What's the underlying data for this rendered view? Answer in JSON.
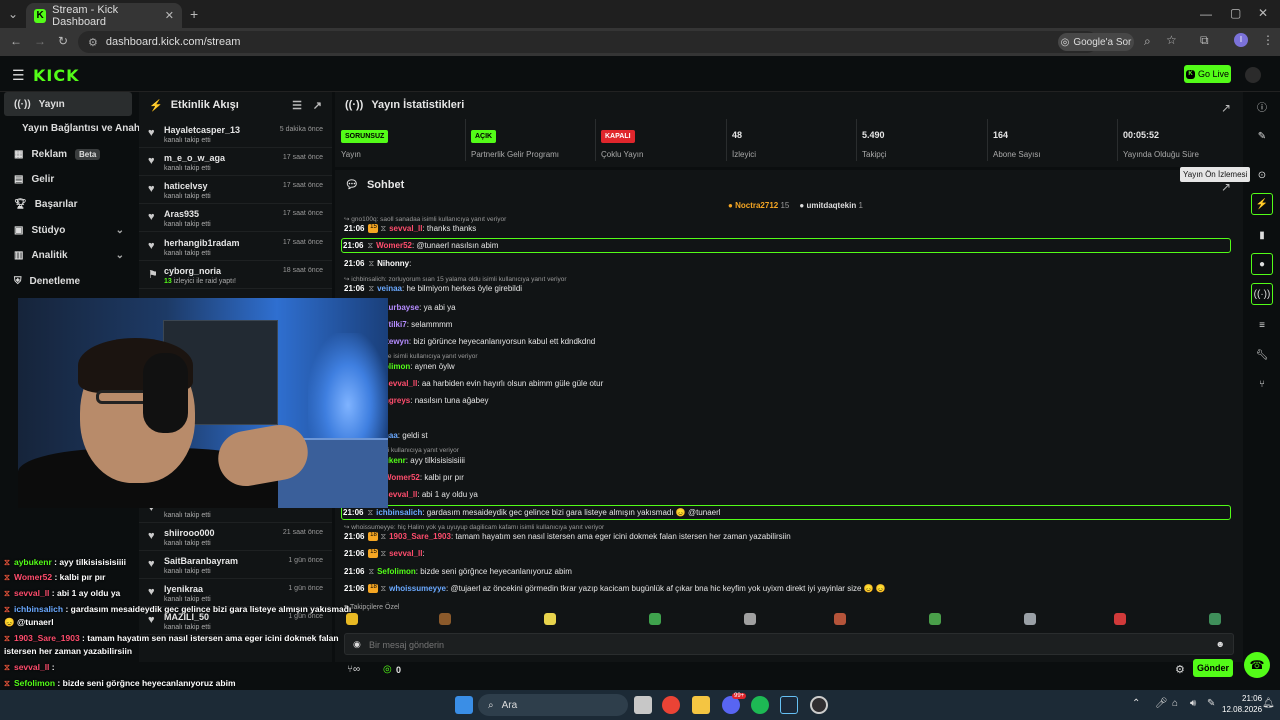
{
  "browser": {
    "tab_title": "Stream - Kick Dashboard",
    "url": "dashboard.kick.com/stream",
    "google_button": "Google'a Sor",
    "profile_initial": "I"
  },
  "header": {
    "logo": "KICK",
    "go_live": "Go Live"
  },
  "sidebar": {
    "items": [
      {
        "label": "Yayın"
      },
      {
        "label": "Yayın Bağlantısı ve Anahtarı"
      },
      {
        "label": "Reklam",
        "badge": "Beta"
      },
      {
        "label": "Gelir"
      },
      {
        "label": "Başarılar"
      },
      {
        "label": "Stüdyo"
      },
      {
        "label": "Analitik"
      },
      {
        "label": "Denetleme"
      }
    ]
  },
  "activity": {
    "title": "Etkinlik Akışı",
    "items": [
      {
        "name": "Hayaletcasper_13",
        "sub": "kanalı takip etti",
        "time": "5 dakika önce"
      },
      {
        "name": "m_e_o_w_aga",
        "sub": "kanalı takip etti",
        "time": "17 saat önce"
      },
      {
        "name": "haticelvsy",
        "sub": "kanalı takip etti",
        "time": "17 saat önce"
      },
      {
        "name": "Aras935",
        "sub": "kanalı takip etti",
        "time": "17 saat önce"
      },
      {
        "name": "herhangib1radam",
        "sub": "kanalı takip etti",
        "time": "17 saat önce"
      },
      {
        "name": "cyborg_noria",
        "sub_count": "13",
        "sub": "izleyici ile raid yaptı!",
        "time": "18 saat önce"
      },
      {
        "name": "",
        "sub": "kanalı takip etti",
        "time": ""
      },
      {
        "name": "shiirooo000",
        "sub": "kanalı takip etti",
        "time": "21 saat önce"
      },
      {
        "name": "SaitBaranbayram",
        "sub": "kanalı takip etti",
        "time": "1 gün önce"
      },
      {
        "name": "lyenikraa",
        "sub": "kanalı takip etti",
        "time": "1 gün önce"
      },
      {
        "name": "MAZILI_50",
        "sub": "kanalı takip etti",
        "time": "1 gün önce"
      }
    ]
  },
  "stats": {
    "title": "Yayın İstatistikleri",
    "items": [
      {
        "badge": "SORUNSUZ",
        "badge_color": "#53fc18",
        "label": "Yayın"
      },
      {
        "badge": "AÇIK",
        "badge_color": "#53fc18",
        "label": "Partnerlik Gelir Programı"
      },
      {
        "badge": "KAPALI",
        "badge_color": "#e0262c",
        "label": "Çoklu Yayın"
      },
      {
        "value": "48",
        "label": "İzleyici"
      },
      {
        "value": "5.490",
        "label": "Takipçi"
      },
      {
        "value": "164",
        "label": "Abone Sayısı"
      },
      {
        "value": "00:05:52",
        "label": "Yayında Olduğu Süre"
      }
    ]
  },
  "chat": {
    "title": "Sohbet",
    "pinned": [
      {
        "name": "Noctra2712",
        "count": "15"
      },
      {
        "name": "umitdaqtekin",
        "count": "1"
      }
    ],
    "messages": [
      {
        "reply": "gno100q: saoll sanadaa isimli kullanıcıya yanıt veriyor"
      },
      {
        "time": "21:06",
        "sub": "15",
        "user": "sevval_ll",
        "color": "#ff4d6d",
        "text": "thanks thanks"
      },
      {
        "time": "21:06",
        "sub": "",
        "user": "Womer52",
        "color": "#ff4d6d",
        "text": "@tunaerl nasılsın abim",
        "highlight": true
      },
      {
        "time": "21:06",
        "sub": "",
        "user": "Nihonny",
        "color": "#ffffff",
        "text": ""
      },
      {
        "reply": "ichbinsalich: zorluyorum sıan 15 yalama oldu isimli kullanıcıya yanıt veriyor"
      },
      {
        "time": "21:06",
        "sub": "",
        "user": "veinaa",
        "color": "#6aa9ff",
        "text": "he bilmiyom herkes öyle girebildi"
      },
      {
        "time": "",
        "user": "kurbayse",
        "color": "#b58cff",
        "text": "ya abi ya"
      },
      {
        "time": "",
        "user": "7tilki7",
        "color": "#b58cff",
        "text": "selammmm"
      },
      {
        "time": "",
        "user": "ltewyn",
        "color": "#b58cff",
        "text": "bizi görünce heyecanlanıyorsun kabul ett kdndkdnd"
      },
      {
        "reply": "36: + cimcime isimli kullanıcıya yanıt veriyor"
      },
      {
        "time": "",
        "user": "olimon",
        "color": "#53fc18",
        "text": "aynen öylw"
      },
      {
        "time": "",
        "user": "sevval_ll",
        "color": "#ff4d6d",
        "text": "aa harbiden evin hayırlı olsun abimm güle güle otur"
      },
      {
        "time": "",
        "user": "ngreys",
        "color": "#ff4d6d",
        "text": "nasılsın tuna ağabey"
      },
      {
        "time": "",
        "user": "",
        "color": "#ffffff",
        "text": ""
      },
      {
        "time": "",
        "user": "naa",
        "color": "#6aa9ff",
        "text": "geldi st"
      },
      {
        "reply": "mmmm isimli kullanıcıya yanıt veriyor"
      },
      {
        "time": "",
        "user": "ukenr",
        "color": "#53fc18",
        "text": "ayy tilkisisisisiiii"
      },
      {
        "time": "",
        "user": "Womer52",
        "color": "#ff4d6d",
        "text": "kalbi pır pır"
      },
      {
        "time": "",
        "user": "sevval_ll",
        "color": "#ff4d6d",
        "text": "abi 1 ay oldu ya"
      },
      {
        "time": "21:06",
        "sub": "",
        "user": "ichbinsalich",
        "color": "#6aa9ff",
        "text": "gardasım mesaideydik gec gelince bizi gara listeye almışın yakısmadı 😞 @tunaerl",
        "highlight": true
      },
      {
        "reply": "whoissumeyye: hiç Halim yok ya uyuyup dagilicam kafamı isimli kullanıcıya yanıt veriyor"
      },
      {
        "time": "21:06",
        "sub": "18",
        "user": "1903_Sare_1903",
        "color": "#ff4d6d",
        "text": "tamam hayatım sen nasıl istersen ama eger icini dokmek falan istersen her zaman yazabilirsiin"
      },
      {
        "time": "21:06",
        "sub": "15",
        "user": "sevval_ll",
        "color": "#ff4d6d",
        "text": ""
      },
      {
        "time": "21:06",
        "sub": "",
        "user": "Sefolimon",
        "color": "#53fc18",
        "text": "bizde seni görğnce heyecanlanıyoruz abim"
      },
      {
        "time": "21:06",
        "sub": "18",
        "user": "whoissumeyye",
        "color": "#6aa9ff",
        "text": "@tujaerl az öncekini görmedin tkrar yazıp kacicam bugünlük af çıkar bna hic keyfim yok uyixm direkt iyi yayinlar size 😞 😞"
      }
    ],
    "emotes_label": "Takipçilere Özel",
    "input_placeholder": "Bir mesaj gönderin",
    "viewer_count": "0",
    "send_label": "Gönder"
  },
  "rail": {
    "tooltip": "Yayın Ön İzlemesi"
  },
  "overlay_chat": [
    {
      "user": "aybukenr",
      "color": "#53fc18",
      "text": "ayy tilkisisisisiiii"
    },
    {
      "user": "Womer52",
      "color": "#ff4d6d",
      "text": "kalbi pır pır"
    },
    {
      "user": "sevval_ll",
      "color": "#ff4d6d",
      "text": "abi 1 ay oldu ya"
    },
    {
      "user": "ichbinsalich",
      "color": "#6aa9ff",
      "text": "gardasım mesaideydik gec gelince bizi gara listeye almışın yakısmadı"
    },
    {
      "user": "",
      "color": "#6aa9ff",
      "text": "😞 @tunaerl"
    },
    {
      "user": "1903_Sare_1903",
      "color": "#ff4d6d",
      "text": "tamam hayatım sen nasıl istersen ama eger icini dokmek falan"
    },
    {
      "user": "",
      "color": "#ffffff",
      "text": "istersen her zaman yazabilirsiin"
    },
    {
      "user": "sevval_ll",
      "color": "#ff4d6d",
      "text": ""
    },
    {
      "user": "Sefolimon",
      "color": "#53fc18",
      "text": "bizde seni görğnce heyecanlanıyoruz abim"
    },
    {
      "user": "whoissumeyye",
      "color": "#6aa9ff",
      "text": "@tujaerl az öncekini görmedin tkrar yazıp kacicam bugünlük af çıkar"
    },
    {
      "user": "",
      "color": "#ffffff",
      "text": "bna hic keyfim yok uyixm direkt iyi yayinlar size 😞 😞"
    }
  ],
  "taskbar": {
    "search": "Ara",
    "time": "21:06",
    "date": "12.08.2026",
    "discord_badge": "99+"
  }
}
